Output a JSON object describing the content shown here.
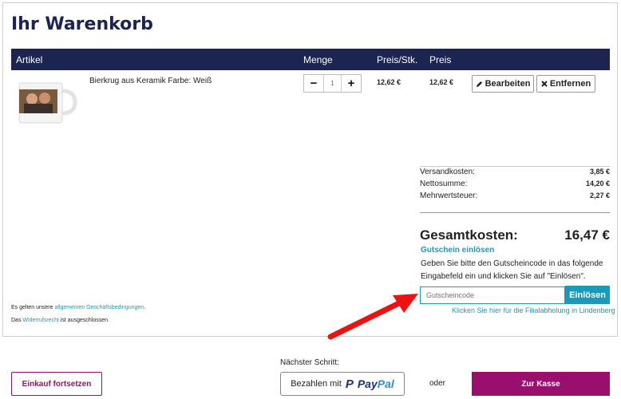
{
  "cart": {
    "title": "Ihr Warenkorb",
    "columns": {
      "article": "Artikel",
      "quantity": "Menge",
      "unit_price": "Preis/Stk.",
      "price": "Preis"
    },
    "items": [
      {
        "name": "Bierkrug aus Keramik Farbe: Weiß",
        "quantity": "1",
        "unit_price": "12,62 €",
        "price": "12,62 €",
        "edit_label": "Bearbeiten",
        "remove_label": "Entfernen",
        "minus_label": "−",
        "plus_label": "+"
      }
    ]
  },
  "summary": {
    "shipping_label": "Versandkosten:",
    "shipping_value": "3,85 €",
    "net_label": "Nettosumme:",
    "net_value": "14,20 €",
    "vat_label": "Mehrwertsteuer:",
    "vat_value": "2,27 €",
    "total_label": "Gesamtkosten:",
    "total_value": "16,47 €"
  },
  "coupon": {
    "link": "Gutschein einlösen",
    "instructions": "Geben Sie bitte den Gutscheincode in das folgende Eingabefeld ein und klicken Sie auf \"Einlösen\".",
    "placeholder": "Gutscheincode",
    "button": "Einlösen",
    "pickup_link": "Klicken Sie hier für die Filialabholung in Lindenberg"
  },
  "terms": {
    "line1_prefix": "Es gelten unsere ",
    "line1_link": "allgemeinen Geschäftsbedingungen",
    "line1_suffix": ".",
    "line2_prefix": "Das ",
    "line2_link": "Widerrufsrecht",
    "line2_suffix": " ist ausgeschlossen."
  },
  "footer": {
    "next_step": "Nächster Schritt:",
    "continue_label": "Einkauf fortsetzen",
    "paypal_prefix": "Bezahlen mit",
    "paypal_brand_1": "Pay",
    "paypal_brand_2": "Pal",
    "or_label": "oder",
    "checkout_label": "Zur Kasse"
  },
  "colors": {
    "navy": "#1c2552",
    "accent": "#1a9ab8",
    "magenta": "#9a0e6e",
    "arrow": "#ee1111"
  }
}
